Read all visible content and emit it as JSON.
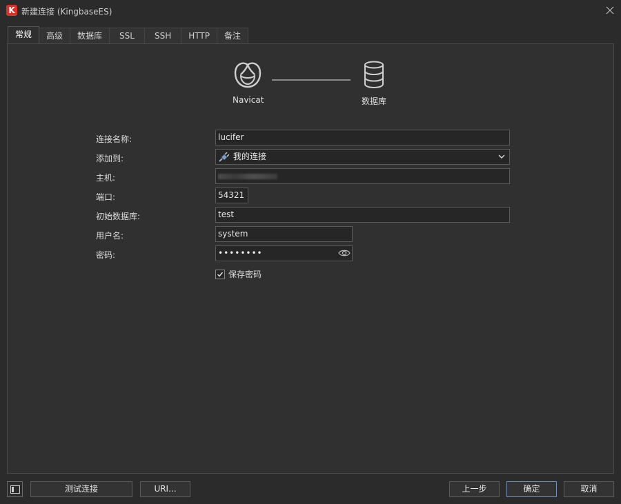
{
  "window": {
    "title": "新建连接 (KingbaseES)",
    "app_icon_letter": "K",
    "accent": "#d9322b"
  },
  "tabs": [
    {
      "label": "常规",
      "active": true
    },
    {
      "label": "高级"
    },
    {
      "label": "数据库"
    },
    {
      "label": "SSL"
    },
    {
      "label": "SSH"
    },
    {
      "label": "HTTP"
    },
    {
      "label": "备注"
    }
  ],
  "diagram": {
    "left_label": "Navicat",
    "right_label": "数据库"
  },
  "form": {
    "connection_name": {
      "label": "连接名称:",
      "value": "lucifer"
    },
    "add_to": {
      "label": "添加到:",
      "value": "我的连接"
    },
    "host": {
      "label": "主机:",
      "value": ""
    },
    "port": {
      "label": "端口:",
      "value": "54321"
    },
    "initial_db": {
      "label": "初始数据库:",
      "value": "test"
    },
    "username": {
      "label": "用户名:",
      "value": "system"
    },
    "password": {
      "label": "密码:",
      "value": "••••••••"
    },
    "save_password": {
      "label": "保存密码",
      "checked": true
    }
  },
  "footer": {
    "test_connection": "测试连接",
    "uri": "URI...",
    "previous": "上一步",
    "ok": "确定",
    "cancel": "取消"
  }
}
